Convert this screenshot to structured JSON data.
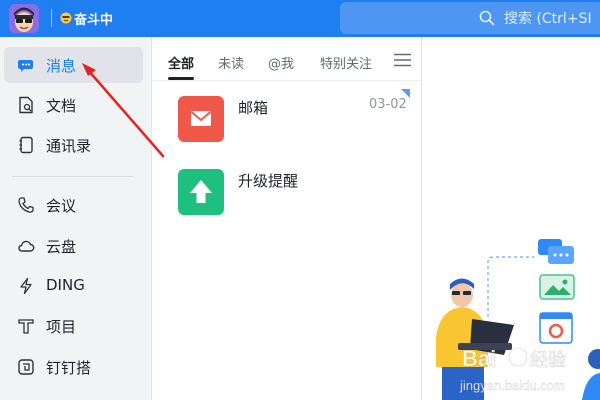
{
  "topbar": {
    "status_text": "奋斗中",
    "search_placeholder": "搜索 (Ctrl+SI"
  },
  "sidebar": {
    "items": [
      {
        "label": "消息",
        "icon": "message-icon"
      },
      {
        "label": "文档",
        "icon": "document-icon"
      },
      {
        "label": "通讯录",
        "icon": "contacts-icon"
      },
      {
        "label": "会议",
        "icon": "phone-icon"
      },
      {
        "label": "云盘",
        "icon": "cloud-icon"
      },
      {
        "label": "DING",
        "icon": "lightning-icon"
      },
      {
        "label": "项目",
        "icon": "project-icon"
      },
      {
        "label": "钉钉搭",
        "icon": "builder-icon"
      }
    ]
  },
  "tabs": [
    "全部",
    "未读",
    "@我",
    "特别关注"
  ],
  "conversations": [
    {
      "name": "邮箱",
      "time": "03-02",
      "icon": "mail-icon"
    },
    {
      "name": "升级提醒",
      "time": "",
      "icon": "upgrade-arrow-icon"
    }
  ],
  "watermark": {
    "line1": "Bai",
    "line2": "经验",
    "line3": "jingyan.baidu.com"
  },
  "colors": {
    "primary": "#1f7ef0",
    "mail": "#f0594a",
    "upgrade": "#1fbf80",
    "annotation_arrow": "#e52222"
  }
}
